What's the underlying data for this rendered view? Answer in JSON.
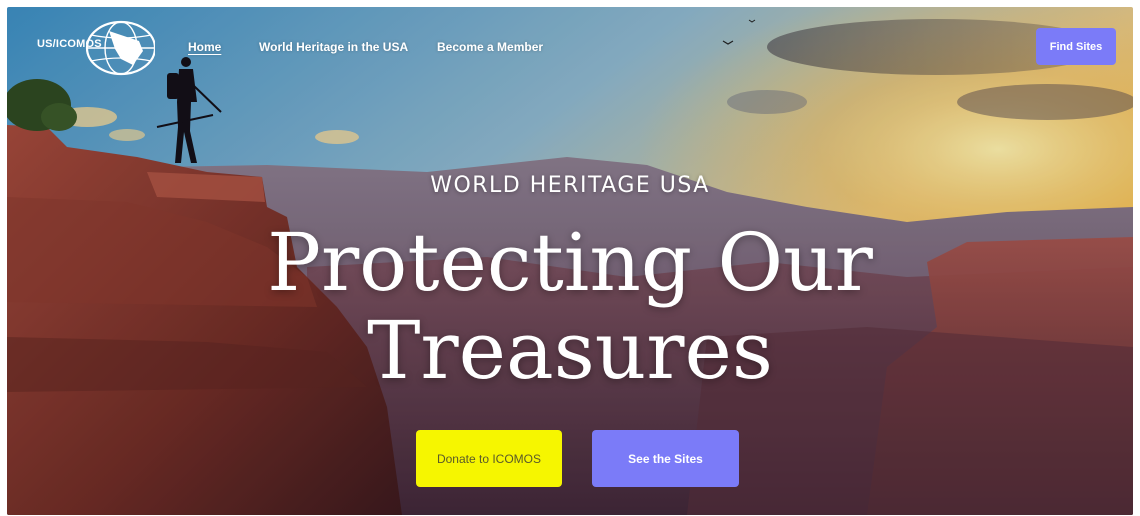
{
  "logo": {
    "text": "US/ICOMOS",
    "icon": "globe-logo-icon"
  },
  "nav": {
    "links": [
      {
        "label": "Home",
        "active": true
      },
      {
        "label": "World Heritage in the USA",
        "active": false
      },
      {
        "label": "Become a Member",
        "active": false
      }
    ],
    "find_sites_label": "Find Sites"
  },
  "hero": {
    "eyebrow": "WORLD HERITAGE USA",
    "headline_line1": "Protecting Our",
    "headline_line2": "Treasures"
  },
  "cta": {
    "donate_label": "Donate to ICOMOS",
    "see_sites_label": "See the Sites"
  },
  "colors": {
    "accent": "#7b7bf8",
    "donate": "#f6f600"
  }
}
